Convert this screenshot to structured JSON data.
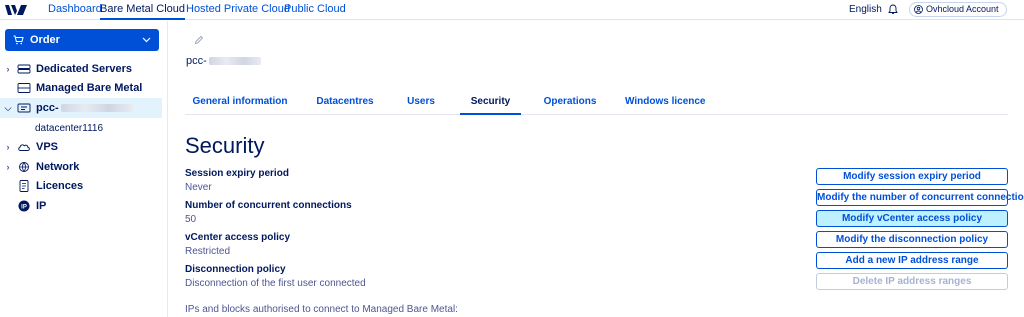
{
  "topnav": {
    "items": [
      "Dashboard",
      "Bare Metal Cloud",
      "Hosted Private Cloud",
      "Public Cloud"
    ],
    "active_index": 1,
    "language": "English",
    "account": "Ovhcloud Account"
  },
  "sidebar": {
    "order_label": "Order",
    "tree": [
      {
        "label": "Dedicated Servers",
        "icon": "server-icon",
        "expandable": true
      },
      {
        "label": "Managed Bare Metal",
        "icon": "rack-icon",
        "expandable": false
      },
      {
        "label": "pcc-",
        "icon": "pcc-icon",
        "expandable": true,
        "selected": true
      },
      {
        "label": "datacenter1116",
        "child": true
      },
      {
        "label": "VPS",
        "icon": "cloud-icon",
        "expandable": true
      },
      {
        "label": "Network",
        "icon": "network-icon",
        "expandable": true
      },
      {
        "label": "Licences",
        "icon": "licence-icon",
        "expandable": false
      },
      {
        "label": "IP",
        "icon": "ip-icon",
        "expandable": false
      }
    ]
  },
  "main": {
    "service_name": "pcc-",
    "tabs": [
      "General information",
      "Datacentres",
      "Users",
      "Security",
      "Operations",
      "Windows licence"
    ],
    "active_tab": 3,
    "heading": "Security",
    "fields": [
      {
        "label": "Session expiry period",
        "value": "Never"
      },
      {
        "label": "Number of concurrent connections",
        "value": "50"
      },
      {
        "label": "vCenter access policy",
        "value": "Restricted"
      },
      {
        "label": "Disconnection policy",
        "value": "Disconnection of the first user connected"
      }
    ],
    "ips_text": "IPs and blocks authorised to connect to Managed Bare Metal:",
    "actions": [
      {
        "label": "Modify session expiry period",
        "state": "normal"
      },
      {
        "label": "Modify the number of concurrent connections",
        "state": "normal"
      },
      {
        "label": "Modify vCenter access policy",
        "state": "hover"
      },
      {
        "label": "Modify the disconnection policy",
        "state": "normal"
      },
      {
        "label": "Add a new IP address range",
        "state": "normal"
      },
      {
        "label": "Delete IP address ranges",
        "state": "disabled"
      }
    ]
  },
  "colors": {
    "brand": "#0050d7",
    "text": "#00185e",
    "hover": "#bef1ff",
    "selected_row": "#e3f3fd"
  }
}
